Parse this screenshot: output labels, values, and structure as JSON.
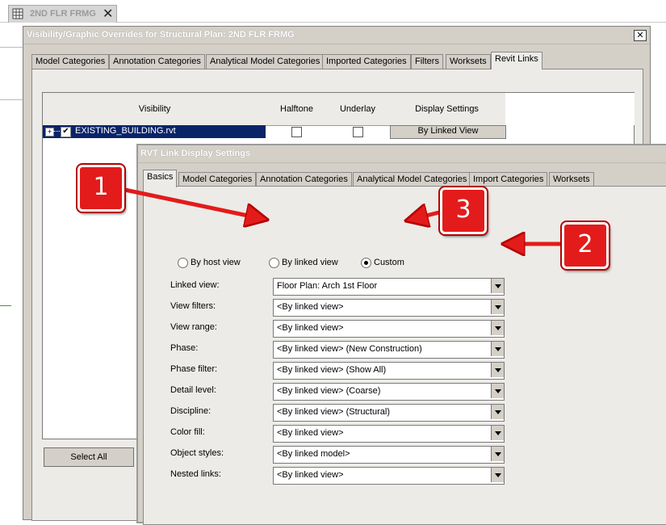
{
  "document_tab": {
    "title": "2ND FLR FRMG",
    "close": "✕"
  },
  "vg_dialog": {
    "title": "Visibility/Graphic Overrides for Structural Plan: 2ND FLR FRMG",
    "close": "✕",
    "tabs": [
      {
        "label": "Model Categories"
      },
      {
        "label": "Annotation Categories"
      },
      {
        "label": "Analytical Model Categories"
      },
      {
        "label": "Imported Categories"
      },
      {
        "label": "Filters"
      },
      {
        "label": "Worksets"
      },
      {
        "label": "Revit Links"
      }
    ],
    "active_tab": "Revit Links",
    "table": {
      "columns": [
        "Visibility",
        "Halftone",
        "Underlay",
        "Display Settings"
      ],
      "rows": [
        {
          "name": "EXISTING_BUILDING.rvt",
          "expand": "+",
          "visible_check": "✔",
          "display_settings": "By Linked View"
        }
      ]
    },
    "select_all": "Select All"
  },
  "rvt_dialog": {
    "title": "RVT Link Display Settings",
    "tabs": [
      {
        "label": "Basics"
      },
      {
        "label": "Model Categories"
      },
      {
        "label": "Annotation Categories"
      },
      {
        "label": "Analytical Model Categories"
      },
      {
        "label": "Import Categories"
      },
      {
        "label": "Worksets"
      }
    ],
    "active_tab": "Basics",
    "radios": [
      {
        "label": "By host view",
        "selected": false
      },
      {
        "label": "By linked view",
        "selected": false
      },
      {
        "label": "Custom",
        "selected": true
      }
    ],
    "fields": [
      {
        "label": "Linked view:",
        "value": "Floor Plan: Arch 1st Floor"
      },
      {
        "label": "View filters:",
        "value": "<By linked view>"
      },
      {
        "label": "View range:",
        "value": "<By linked view>"
      },
      {
        "label": "Phase:",
        "value": "<By linked view> (New Construction)"
      },
      {
        "label": "Phase filter:",
        "value": "<By linked view> (Show All)"
      },
      {
        "label": "Detail level:",
        "value": "<By linked view> (Coarse)"
      },
      {
        "label": "Discipline:",
        "value": "<By linked view> (Structural)"
      },
      {
        "label": "Color fill:",
        "value": "<By linked view>"
      },
      {
        "label": "Object styles:",
        "value": "<By linked model>"
      },
      {
        "label": "Nested links:",
        "value": "<By linked view>"
      }
    ]
  },
  "callouts": [
    {
      "label": "1"
    },
    {
      "label": "2"
    },
    {
      "label": "3"
    }
  ],
  "colors": {
    "callout": "#e31b1b",
    "dialog_bg": "#d4d0c8",
    "selection": "#0a246a"
  }
}
